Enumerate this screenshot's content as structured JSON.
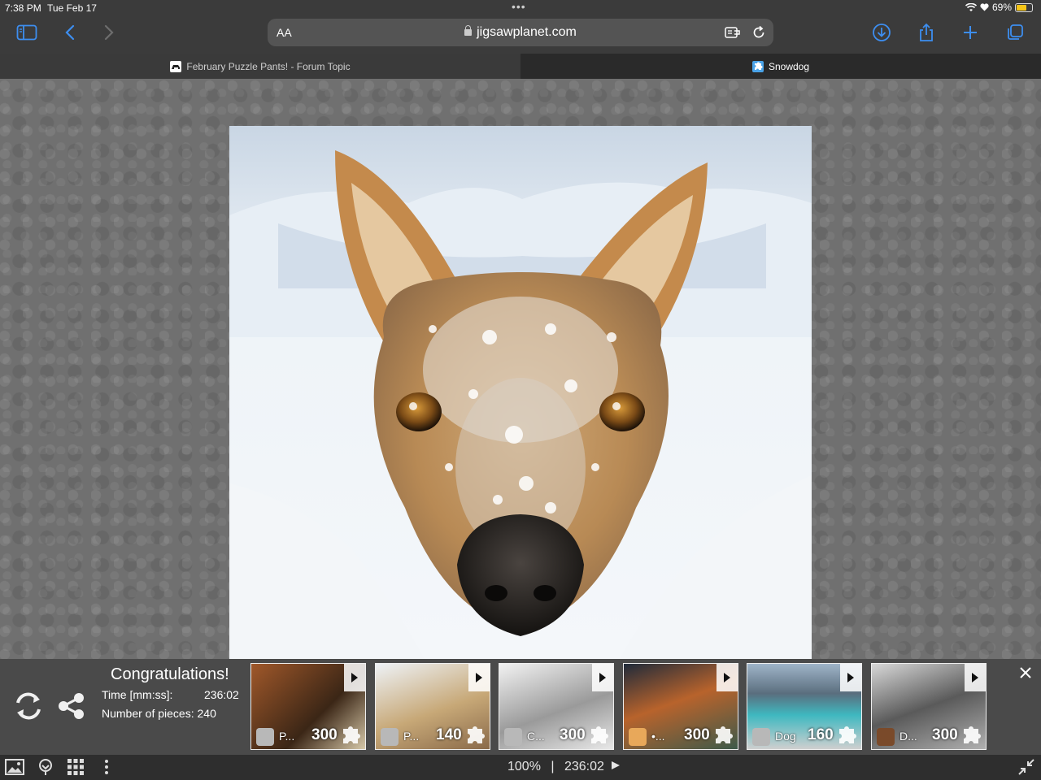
{
  "status_bar": {
    "time": "7:38 PM",
    "date": "Tue Feb 17",
    "battery": "69%",
    "battery_level": 0.69
  },
  "toolbar": {
    "icons": [
      "sidebar-icon",
      "back-icon",
      "forward-icon",
      "download-icon",
      "share-icon",
      "plus-icon",
      "tabs-icon"
    ]
  },
  "url_bar": {
    "text_size_label": "AA",
    "domain": "jigsawplanet.com"
  },
  "tabs": [
    {
      "label": "February Puzzle Pants! - Forum Topic",
      "active": false
    },
    {
      "label": "Snowdog",
      "active": true
    }
  ],
  "result": {
    "title": "Congratulations!",
    "time_label": "Time [mm:ss]:",
    "time_value": "236:02",
    "pieces_label": "Number of pieces: 240"
  },
  "suggestions": [
    {
      "name": "P...",
      "count": "300"
    },
    {
      "name": "P...",
      "count": "140"
    },
    {
      "name": "C...",
      "count": "300"
    },
    {
      "name": "•...",
      "count": "300"
    },
    {
      "name": "Dog",
      "count": "160"
    },
    {
      "name": "D...",
      "count": "300"
    }
  ],
  "bottom_bar": {
    "zoom": "100%",
    "separator": "|",
    "timer": "236:02"
  },
  "colors": {
    "accent": "#3d8ef0",
    "panel": "#4a4a4a",
    "background": "#707070"
  }
}
